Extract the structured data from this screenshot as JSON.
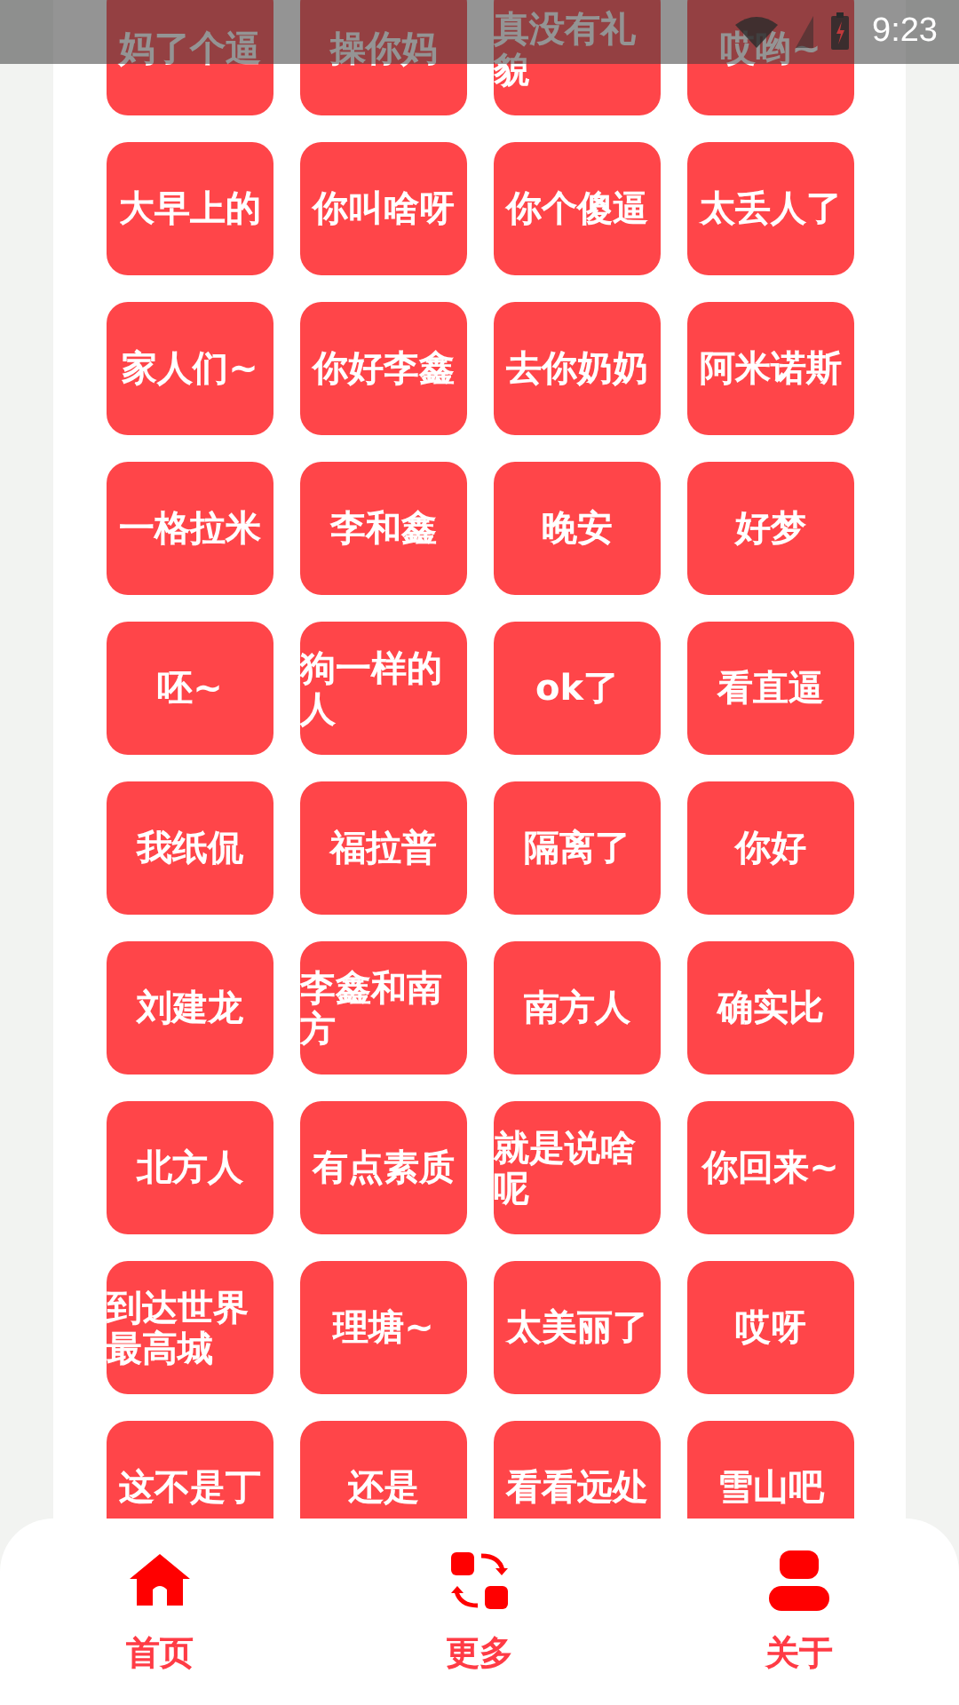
{
  "status_bar": {
    "time": "9:23"
  },
  "buttons": [
    "妈了个逼",
    "操你妈",
    "真没有礼貌",
    "哎哟~",
    "大早上的",
    "你叫啥呀",
    "你个傻逼",
    "太丢人了",
    "家人们~",
    "你好李鑫",
    "去你奶奶",
    "阿米诺斯",
    "一格拉米",
    "李和鑫",
    "晚安",
    "好梦",
    "呸~",
    "狗一样的人",
    "ok了",
    "看直逼",
    "我纸侃",
    "福拉普",
    "隔离了",
    "你好",
    "刘建龙",
    "李鑫和南方",
    "南方人",
    "确实比",
    "北方人",
    "有点素质",
    "就是说啥呢",
    "你回来~",
    "到达世界最高城",
    "理塘~",
    "太美丽了",
    "哎呀",
    "这不是丁",
    "还是",
    "看看远处",
    "雪山吧"
  ],
  "bottom_nav": [
    {
      "label": "首页"
    },
    {
      "label": "更多"
    },
    {
      "label": "关于"
    }
  ]
}
